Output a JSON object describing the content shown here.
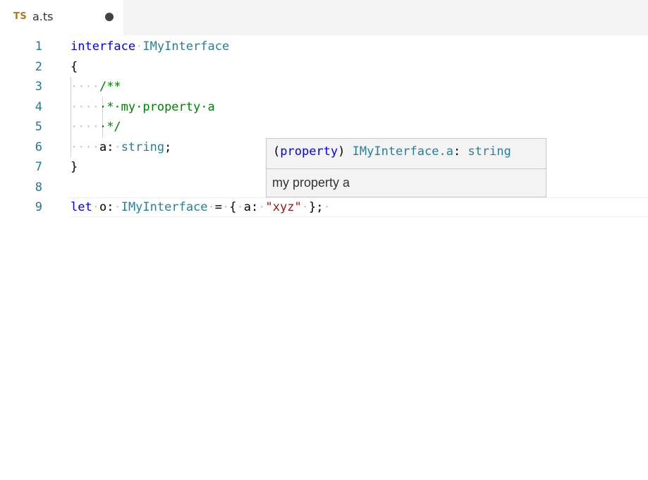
{
  "tab": {
    "language_badge": "TS",
    "file_name": "a.ts",
    "dirty_indicator": "●"
  },
  "editor": {
    "line_numbers": [
      "1",
      "2",
      "3",
      "4",
      "5",
      "6",
      "7",
      "8",
      "9"
    ],
    "lines": {
      "l1": {
        "keyword": "interface",
        "sp": "·",
        "type": "IMyInterface"
      },
      "l2": {
        "brace": "{"
      },
      "l3": {
        "indent": "····",
        "comment": "/**"
      },
      "l4": {
        "indent": "····",
        "comment": "·*·my·property·a"
      },
      "l5": {
        "indent": "····",
        "comment": "·*/"
      },
      "l6": {
        "indent": "····",
        "prop": "a:",
        "sp": "·",
        "type": "string",
        "end": ";"
      },
      "l7": {
        "brace": "}"
      },
      "l9": {
        "keyword": "let",
        "sp1": "·",
        "name": "o:",
        "sp2": "·",
        "type": "IMyInterface",
        "sp3": "·",
        "op": "=",
        "sp4": "·",
        "open": "{",
        "sp5": "·",
        "prop": "a:",
        "sp6": "·",
        "string": "\"xyz\"",
        "sp7": "·",
        "close": "};",
        "trail": "·"
      }
    }
  },
  "hover": {
    "open_paren": "(",
    "kind": "property",
    "close_paren": ")",
    "qualified_name": "IMyInterface.a",
    "colon": ":",
    "type": "string",
    "documentation": "my property a"
  },
  "colors": {
    "keyword": "#0000ff",
    "type": "#267f99",
    "comment": "#008000",
    "string": "#a31515",
    "line_number": "#237893",
    "whitespace_marker": "#c8c8c8"
  }
}
